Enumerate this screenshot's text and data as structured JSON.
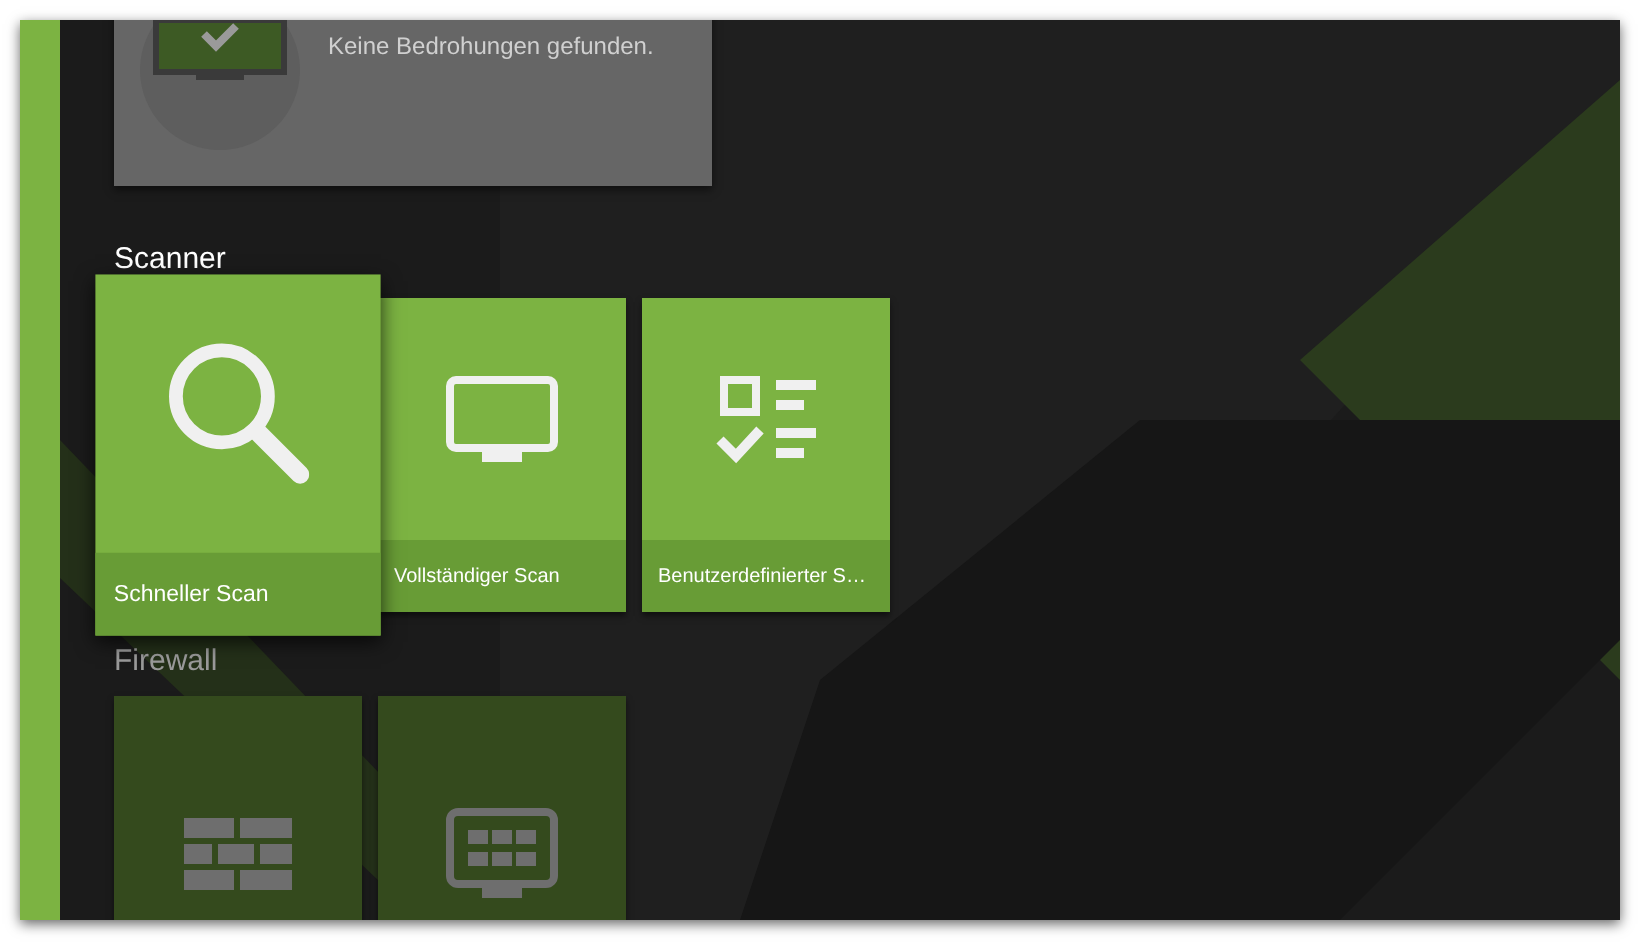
{
  "status_card": {
    "subtitle": "Keine Bedrohungen gefunden."
  },
  "sections": [
    {
      "title": "Scanner",
      "dimmed": false,
      "tiles": [
        {
          "kind": "search",
          "label": "Schneller Scan",
          "selected": true
        },
        {
          "kind": "monitor",
          "label": "Vollständiger Scan",
          "selected": false
        },
        {
          "kind": "checklist",
          "label": "Benutzerdefinierter S…",
          "selected": false
        }
      ]
    },
    {
      "title": "Firewall",
      "dimmed": true,
      "tiles": [
        {
          "kind": "wall",
          "selected": false
        },
        {
          "kind": "monitor-grid",
          "selected": false
        }
      ]
    }
  ]
}
